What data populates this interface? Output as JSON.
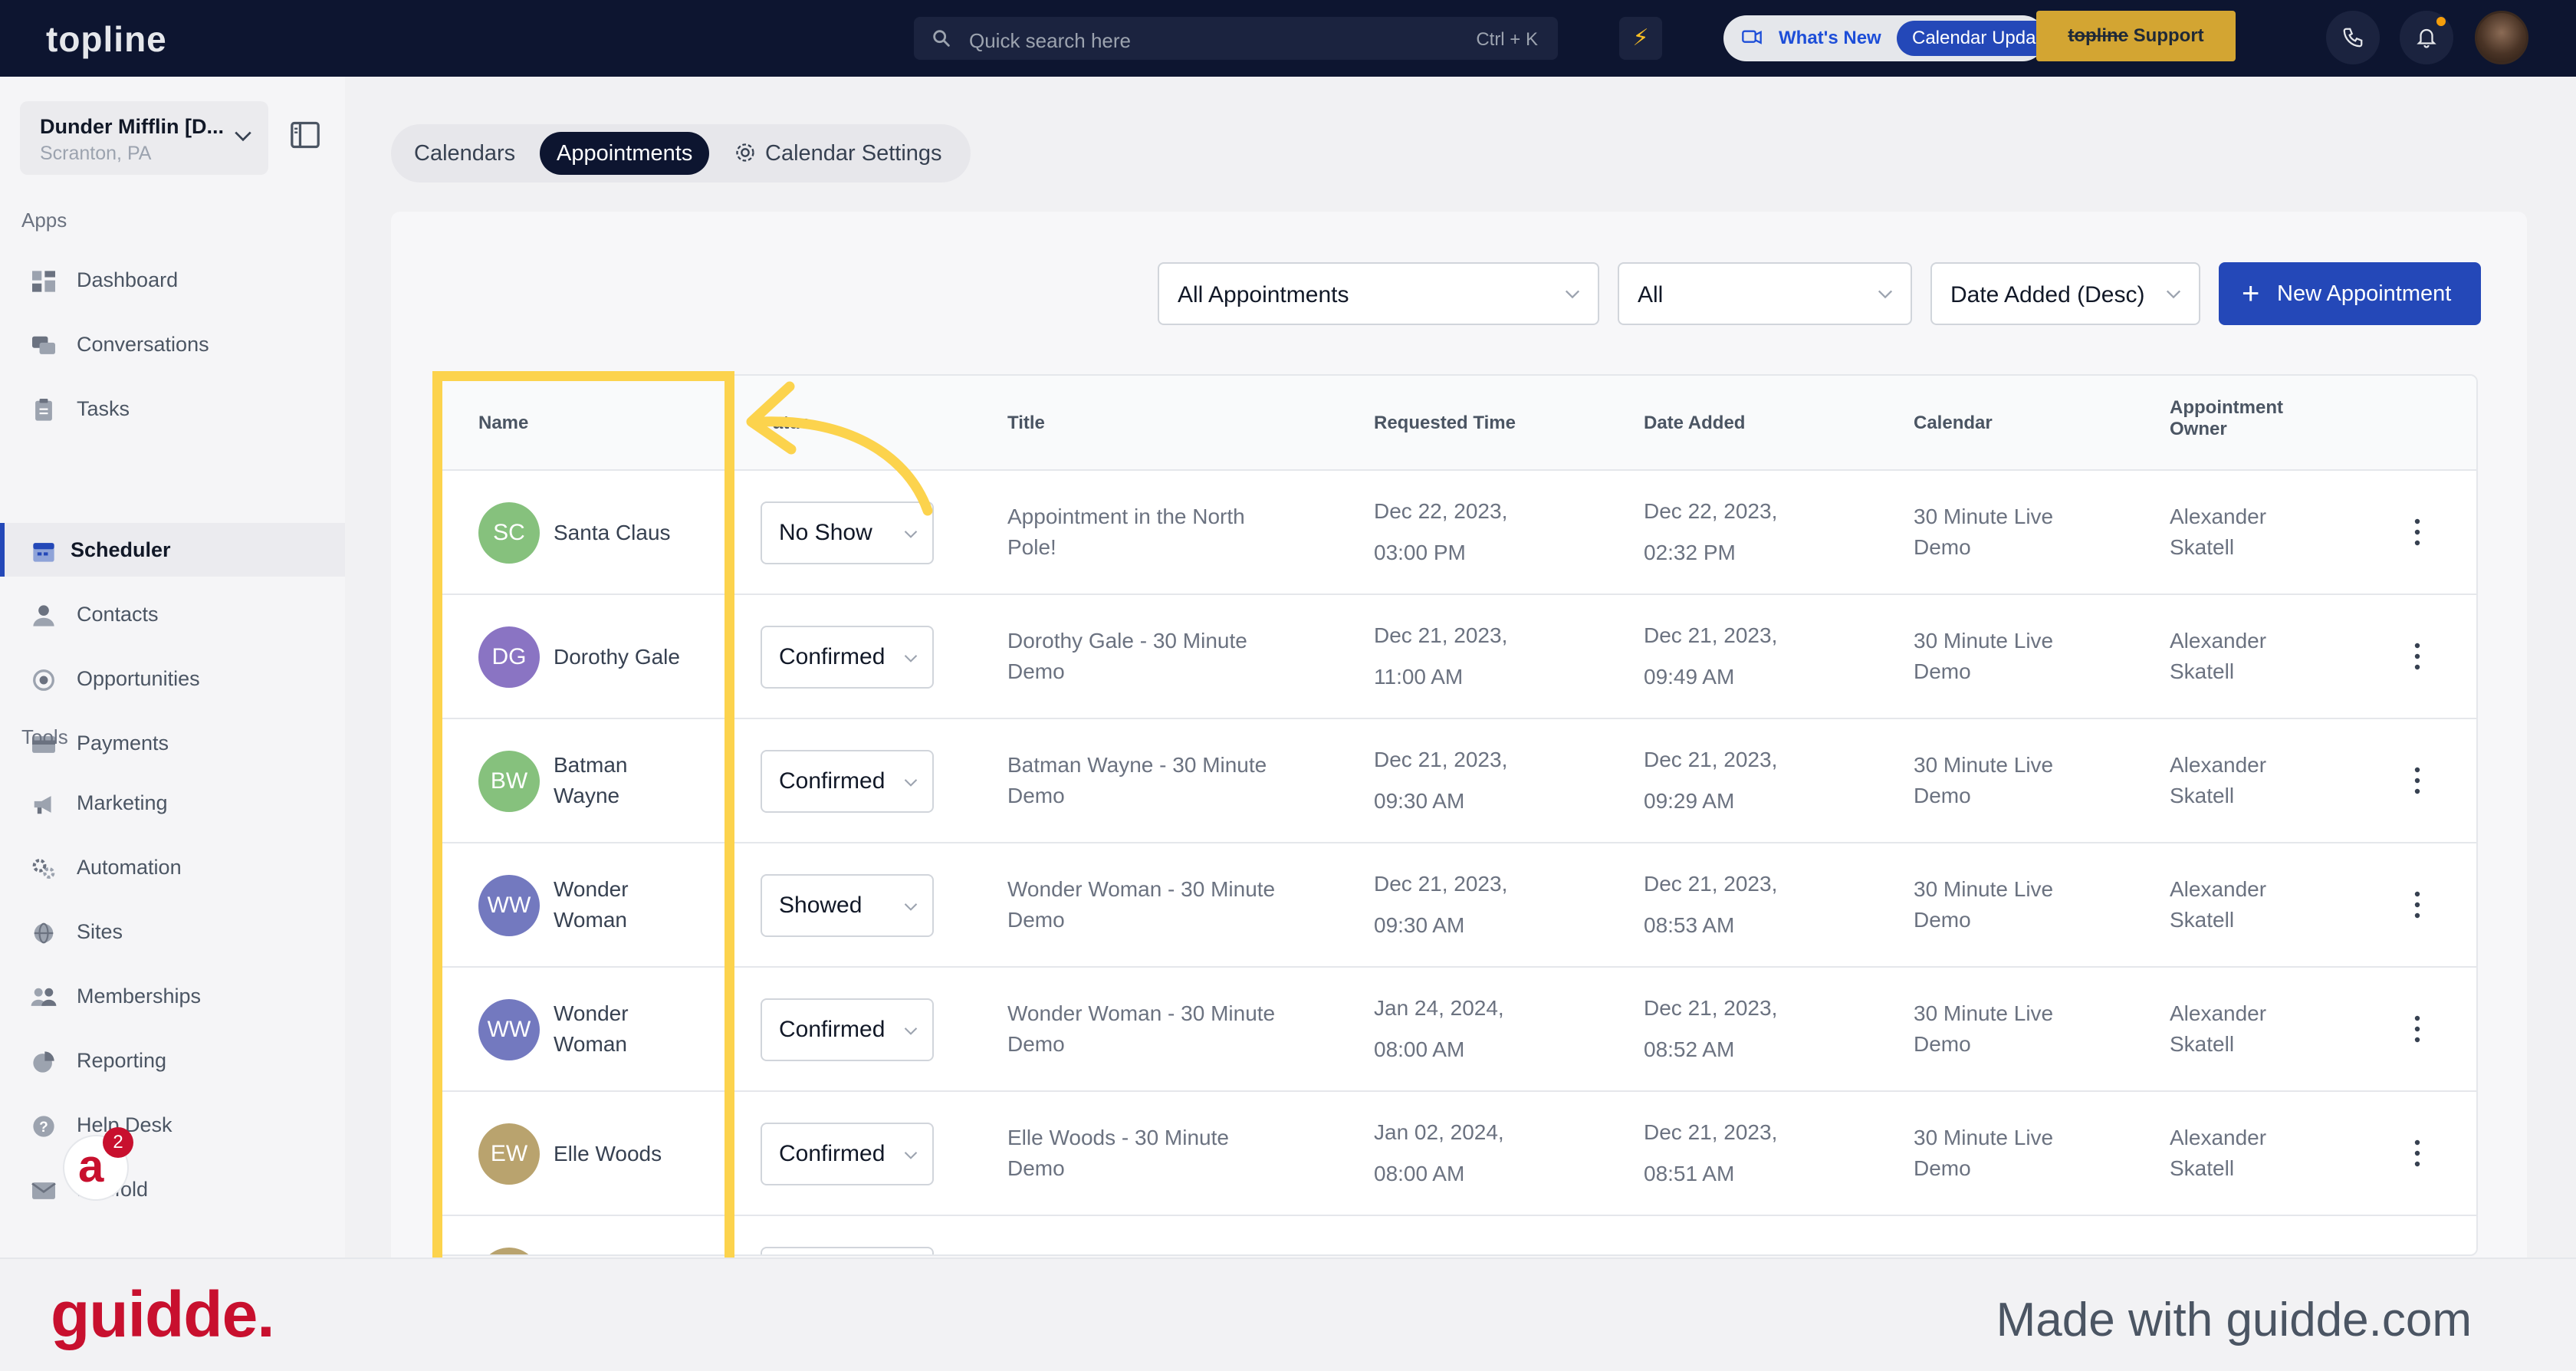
{
  "topbar": {
    "logo": "topline",
    "search_placeholder": "Quick search here",
    "search_shortcut": "Ctrl + K",
    "whats_new": "What's New",
    "calendar_pill": "Calendar Upda",
    "support_brand": "topline",
    "support_label": "Support"
  },
  "sidebar": {
    "location_name": "Dunder Mifflin [D...",
    "location_sub": "Scranton, PA",
    "apps_header": "Apps",
    "tools_header": "Tools",
    "apps": [
      {
        "label": "Dashboard",
        "icon": "dashboard-icon"
      },
      {
        "label": "Conversations",
        "icon": "chat-icon"
      },
      {
        "label": "Tasks",
        "icon": "tasks-icon"
      },
      {
        "label": "Scheduler",
        "icon": "calendar-icon",
        "active": true
      },
      {
        "label": "Contacts",
        "icon": "user-icon"
      },
      {
        "label": "Opportunities",
        "icon": "target-icon"
      },
      {
        "label": "Payments",
        "icon": "card-icon"
      }
    ],
    "tools": [
      {
        "label": "Marketing",
        "icon": "megaphone-icon"
      },
      {
        "label": "Automation",
        "icon": "gears-icon"
      },
      {
        "label": "Sites",
        "icon": "globe-icon"
      },
      {
        "label": "Memberships",
        "icon": "users-icon"
      },
      {
        "label": "Reporting",
        "icon": "pie-chart-icon"
      },
      {
        "label": "Help Desk",
        "icon": "help-icon"
      },
      {
        "label": "Mailfold",
        "icon": "mail-icon"
      }
    ],
    "notification_count": "2"
  },
  "tabs": [
    {
      "label": "Calendars"
    },
    {
      "label": "Appointments",
      "active": true
    },
    {
      "label": "Calendar Settings"
    }
  ],
  "filters": {
    "type": "All Appointments",
    "status": "All",
    "sort": "Date Added (Desc)",
    "new_button": "New Appointment"
  },
  "table": {
    "headers": {
      "name": "Name",
      "status": "atus",
      "title": "Title",
      "requested": "Requested Time",
      "added": "Date Added",
      "calendar": "Calendar",
      "owner_line1": "Appointment",
      "owner_line2": "Owner"
    },
    "rows": [
      {
        "initials": "SC",
        "color": "#86c17d",
        "name_l1": "Santa Claus",
        "name_l2": "",
        "status": "No Show",
        "title_l1": "Appointment in the North",
        "title_l2": "Pole!",
        "req_l1": "Dec 22, 2023,",
        "req_l2": "03:00 PM",
        "add_l1": "Dec 22, 2023,",
        "add_l2": "02:32 PM",
        "cal_l1": "30 Minute Live",
        "cal_l2": "Demo",
        "own_l1": "Alexander",
        "own_l2": "Skatell"
      },
      {
        "initials": "DG",
        "color": "#8a74c3",
        "name_l1": "Dorothy Gale",
        "name_l2": "",
        "status": "Confirmed",
        "title_l1": "Dorothy Gale - 30 Minute",
        "title_l2": "Demo",
        "req_l1": "Dec 21, 2023,",
        "req_l2": "11:00 AM",
        "add_l1": "Dec 21, 2023,",
        "add_l2": "09:49 AM",
        "cal_l1": "30 Minute Live",
        "cal_l2": "Demo",
        "own_l1": "Alexander",
        "own_l2": "Skatell"
      },
      {
        "initials": "BW",
        "color": "#86c17d",
        "name_l1": "Batman",
        "name_l2": "Wayne",
        "status": "Confirmed",
        "title_l1": "Batman Wayne - 30 Minute",
        "title_l2": "Demo",
        "req_l1": "Dec 21, 2023,",
        "req_l2": "09:30 AM",
        "add_l1": "Dec 21, 2023,",
        "add_l2": "09:29 AM",
        "cal_l1": "30 Minute Live",
        "cal_l2": "Demo",
        "own_l1": "Alexander",
        "own_l2": "Skatell"
      },
      {
        "initials": "WW",
        "color": "#7379bf",
        "name_l1": "Wonder",
        "name_l2": "Woman",
        "status": "Showed",
        "title_l1": "Wonder Woman - 30 Minute",
        "title_l2": "Demo",
        "req_l1": "Dec 21, 2023,",
        "req_l2": "09:30 AM",
        "add_l1": "Dec 21, 2023,",
        "add_l2": "08:53 AM",
        "cal_l1": "30 Minute Live",
        "cal_l2": "Demo",
        "own_l1": "Alexander",
        "own_l2": "Skatell"
      },
      {
        "initials": "WW",
        "color": "#7379bf",
        "name_l1": "Wonder",
        "name_l2": "Woman",
        "status": "Confirmed",
        "title_l1": "Wonder Woman - 30 Minute",
        "title_l2": "Demo",
        "req_l1": "Jan 24, 2024,",
        "req_l2": "08:00 AM",
        "add_l1": "Dec 21, 2023,",
        "add_l2": "08:52 AM",
        "cal_l1": "30 Minute Live",
        "cal_l2": "Demo",
        "own_l1": "Alexander",
        "own_l2": "Skatell"
      },
      {
        "initials": "EW",
        "color": "#b9a36e",
        "name_l1": "Elle Woods",
        "name_l2": "",
        "status": "Confirmed",
        "title_l1": "Elle Woods - 30 Minute",
        "title_l2": "Demo",
        "req_l1": "Jan 02, 2024,",
        "req_l2": "08:00 AM",
        "add_l1": "Dec 21, 2023,",
        "add_l2": "08:51 AM",
        "cal_l1": "30 Minute Live",
        "cal_l2": "Demo",
        "own_l1": "Alexander",
        "own_l2": "Skatell"
      }
    ]
  },
  "colors": {
    "highlight": "#fcd34d",
    "accent": "#2448b8",
    "topbar": "#0d1530",
    "guidde_red": "#c8102e"
  },
  "footer": {
    "logo": "guidde.",
    "made_with": "Made with guidde.com"
  }
}
